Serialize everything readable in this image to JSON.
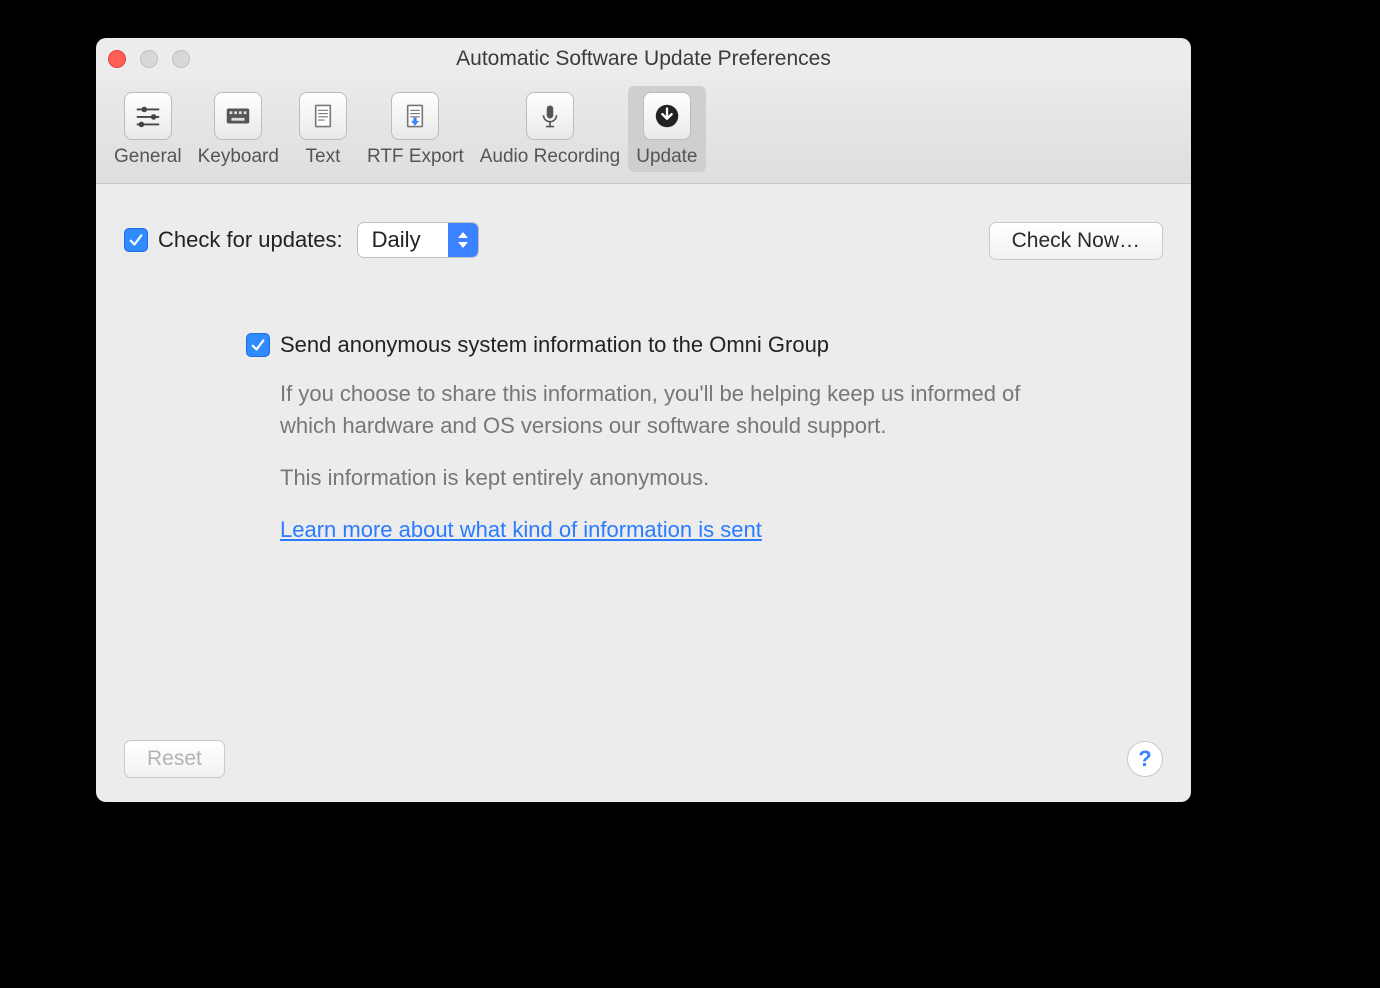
{
  "window": {
    "title": "Automatic Software Update Preferences"
  },
  "toolbar": {
    "items": [
      {
        "label": "General"
      },
      {
        "label": "Keyboard"
      },
      {
        "label": "Text"
      },
      {
        "label": "RTF Export"
      },
      {
        "label": "Audio Recording"
      },
      {
        "label": "Update"
      }
    ]
  },
  "check_row": {
    "label": "Check for updates:",
    "selected": "Daily",
    "button": "Check Now…"
  },
  "anon_row": {
    "label": "Send anonymous system information to the Omni Group"
  },
  "desc1": "If you choose to share this information, you'll be helping keep us informed of which hardware and OS versions our software should support.",
  "desc2": "This information is kept entirely anonymous.",
  "link": "Learn more about what kind of information is sent",
  "footer": {
    "reset": "Reset",
    "help": "?"
  }
}
